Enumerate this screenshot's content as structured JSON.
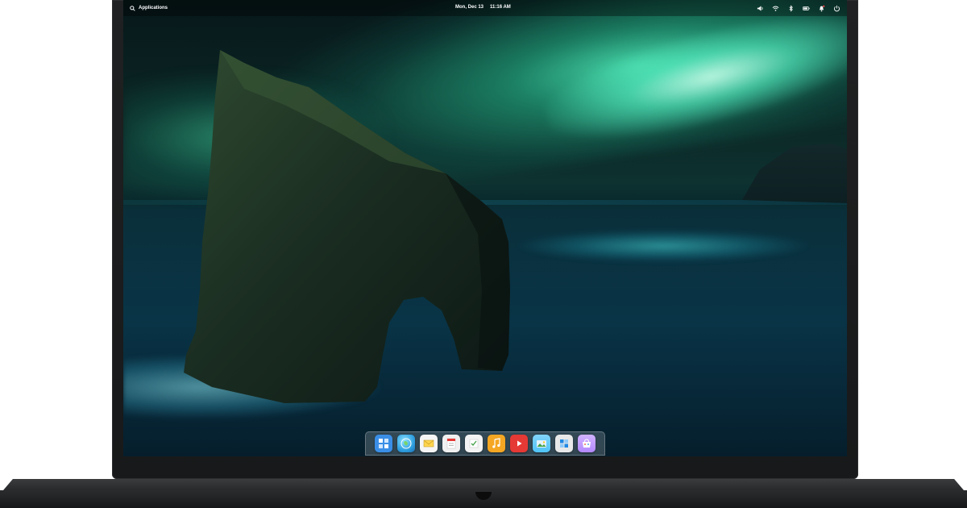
{
  "panel": {
    "applications_label": "Applications",
    "date": "Mon, Dec 13",
    "time": "11:16 AM",
    "indicators": [
      {
        "name": "volume-icon"
      },
      {
        "name": "wifi-icon"
      },
      {
        "name": "bluetooth-icon"
      },
      {
        "name": "battery-icon"
      },
      {
        "name": "notifications-icon"
      },
      {
        "name": "power-icon"
      }
    ]
  },
  "dock": {
    "apps": [
      {
        "name": "multitasking-view-icon",
        "color": "#3a8ee6"
      },
      {
        "name": "web-browser-icon",
        "color": "#2fa0e0"
      },
      {
        "name": "mail-icon",
        "color": "#f5f5f5"
      },
      {
        "name": "calendar-icon",
        "color": "#f0f0f0"
      },
      {
        "name": "tasks-icon",
        "color": "#f3f3f3"
      },
      {
        "name": "music-icon",
        "color": "#f5a623"
      },
      {
        "name": "videos-icon",
        "color": "#e53935"
      },
      {
        "name": "photos-icon",
        "color": "#4fc3f7"
      },
      {
        "name": "system-settings-icon",
        "color": "#e8e8e8"
      },
      {
        "name": "appcenter-icon",
        "color": "#b388ff"
      }
    ]
  },
  "colors": {
    "aurora": "#50f5be",
    "sea": "#093447",
    "bezel": "#1f2122"
  }
}
